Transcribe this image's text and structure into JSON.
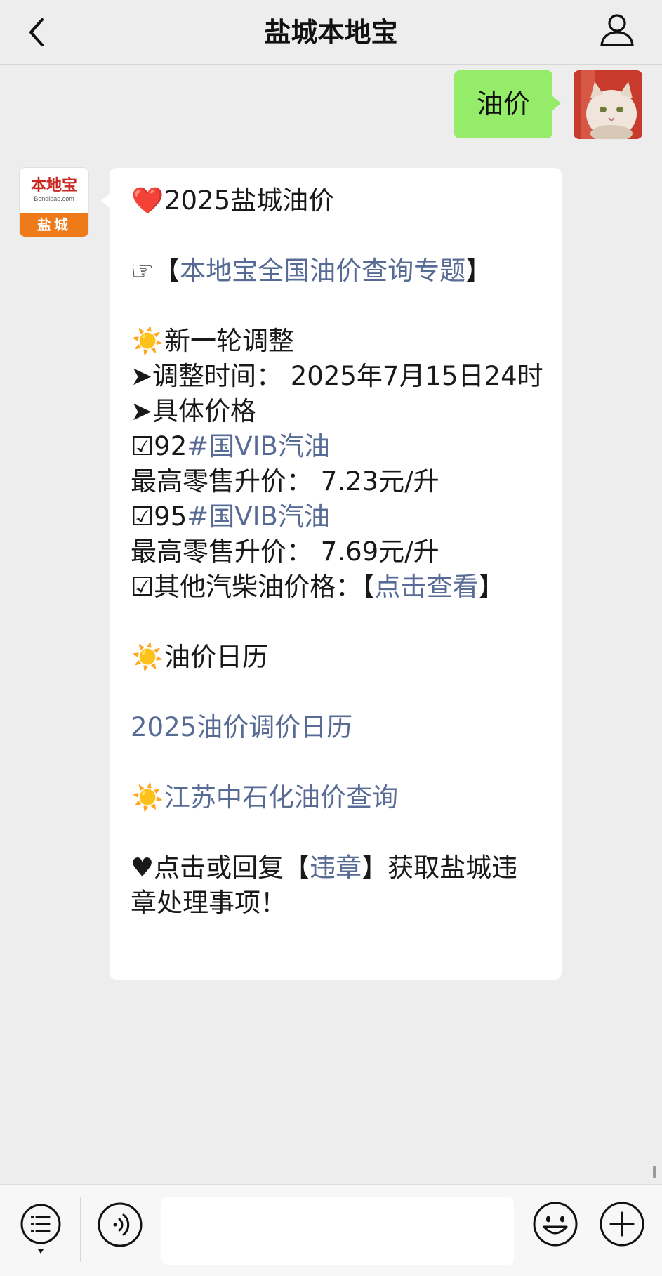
{
  "header": {
    "title": "盐城本地宝",
    "back_icon": "chevron-left-icon",
    "profile_icon": "person-icon"
  },
  "outgoing": {
    "text": "油价",
    "bubble_color": "#95ec69"
  },
  "incoming": {
    "avatar": {
      "logo_text": "本地宝",
      "logo_domain": "Bendibao.com",
      "city": "盐城",
      "accent": "#ef7a1a"
    },
    "heading_emoji": "❤️",
    "heading": "2025盐城油价",
    "topic_prefix": "☞【",
    "topic_link": "本地宝全国油价查询专题",
    "topic_suffix": "】",
    "sun_emoji": "☀️",
    "section1": "新一轮调整",
    "adjust_time": "➤调整时间： 2025年7月15日24时",
    "specific_price": "➤具体价格",
    "item92_prefix": "☑92",
    "item92_link": "#国VIB汽油",
    "item92_price": "最高零售升价： 7.23元/升",
    "item95_prefix": "☑95",
    "item95_link": "#国VIB汽油",
    "item95_price": "最高零售升价： 7.69元/升",
    "other_prefix": "☑其他汽柴油价格：【",
    "other_link": "点击查看",
    "other_suffix": "】",
    "section2": "油价日历",
    "calendar_link": "2025油价调价日历",
    "sinopec_link": "江苏中石化油价查询",
    "footer_heart": "♥",
    "footer_prefix": "点击或回复【",
    "footer_link": "违章",
    "footer_suffix": "】获取盐城违章处理事项！",
    "link_color": "#576b95"
  },
  "bottom_bar": {
    "menu_icon": "list-menu-icon",
    "voice_icon": "voice-icon",
    "input_value": "",
    "emoji_icon": "smiley-icon",
    "plus_icon": "plus-icon"
  }
}
